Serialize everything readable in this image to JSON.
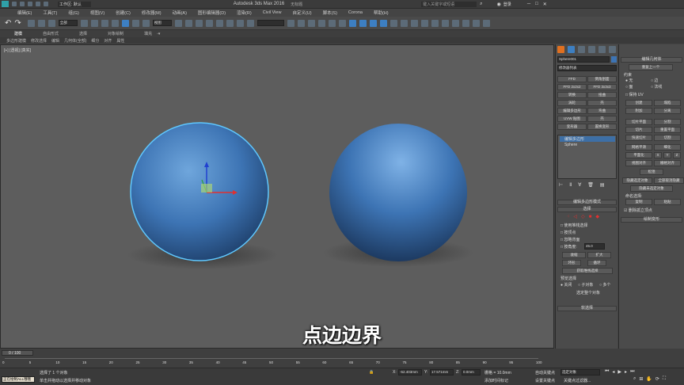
{
  "titlebar": {
    "workspace": "工作区: 默认",
    "app_title": "Autodesk 3ds Max 2016",
    "file_name": "无标题",
    "search_placeholder": "键入关键字或短语",
    "login": "登录"
  },
  "menu": [
    "编辑(E)",
    "工具(T)",
    "组(G)",
    "视图(V)",
    "创建(C)",
    "修改器(M)",
    "动画(A)",
    "图形编辑器(D)",
    "渲染(R)",
    "Civil View",
    "自定义(U)",
    "脚本(S)",
    "Corona",
    "帮助(H)"
  ],
  "toolbar": {
    "filter": "全部",
    "coord": "视图"
  },
  "ribbon": {
    "tabs": [
      "建模",
      "自由形式",
      "选择",
      "对象绘制",
      "填充"
    ]
  },
  "subribbon": {
    "items": [
      "多边形建模",
      "修改选择",
      "编辑",
      "几何体(全部)",
      "细分",
      "对齐",
      "属性"
    ]
  },
  "viewport": {
    "label": "[+] [透视] [真实]",
    "caption": "点边边界"
  },
  "command_panel": {
    "object_name": "Sphere001",
    "modifier_list": "修改器列表",
    "mod_buttons": [
      "FFD",
      "倒角剖面",
      "FFD 2x2x2",
      "FFD 3x3x3",
      "转换",
      "扭曲",
      "涡轮",
      "壳",
      "编辑多边形",
      "弯曲",
      "UVW 贴图",
      "壳",
      "变形器",
      "置换变形"
    ],
    "stack": [
      "编辑多边形",
      "Sphere"
    ],
    "rollout_mode": "编辑多边形模式",
    "rollout_select": "选择",
    "checks": [
      "使用堆栈选择",
      "按顶点",
      "忽略背面",
      "按角度:"
    ],
    "angle_value": "45.0",
    "grow": "收缩",
    "shrink": "扩大",
    "ring": "环形",
    "loop": "循环",
    "get_stack": "获取堆栈选择",
    "preview_title": "预览选择",
    "preview_opts": [
      "关闭",
      "子对象",
      "多个"
    ],
    "selected": "选定整个对象",
    "soft": "软选择"
  },
  "right_panel": {
    "title": "编辑几何体",
    "repeat": "重复上一个",
    "constraints": "约束",
    "constraint_opts": [
      "无",
      "边",
      "面",
      "法线"
    ],
    "keep_uv": "保持 UV",
    "buttons": [
      "创建",
      "塌陷",
      "附加",
      "分离",
      "切片平面",
      "分割",
      "切片",
      "重置平面",
      "快速切片",
      "切割",
      "网格平滑",
      "细化",
      "平面化",
      "X",
      "Y",
      "Z",
      "视图对齐",
      "栅格对齐",
      "松弛",
      "隐藏选定对象",
      "全部取消隐藏",
      "隐藏未选定对象",
      "复制",
      "粘贴"
    ],
    "named_sel": "命名选择:",
    "delete_iso": "删除孤立顶点",
    "paint": "绘制变形"
  },
  "timeline": {
    "frame": "0 / 100",
    "ticks": [
      "0",
      "5",
      "10",
      "15",
      "20",
      "25",
      "30",
      "35",
      "40",
      "45",
      "50",
      "55",
      "60",
      "65",
      "70",
      "75",
      "80",
      "85",
      "90",
      "95",
      "100"
    ]
  },
  "status": {
    "maxscript": "正在绘制ALL哦哦",
    "message": "选择了 1 个对象",
    "hint": "单击并拖动以选择并移动对象",
    "x": "-62.403mm",
    "y": "17.571mm",
    "z": "0.0mm",
    "grid": "栅格 = 10.0mm",
    "addtag": "添加时间标记",
    "autokey": "自动关键点",
    "selected_obj": "选定对象",
    "setkey": "设置关键点",
    "keyfilter": "关键点过滤器..."
  },
  "colors": {
    "sphere": "#3d74b4",
    "viewport": "#5d5d5d",
    "select_highlight": "#5fc8ff",
    "accent": "#3d7fc2"
  }
}
